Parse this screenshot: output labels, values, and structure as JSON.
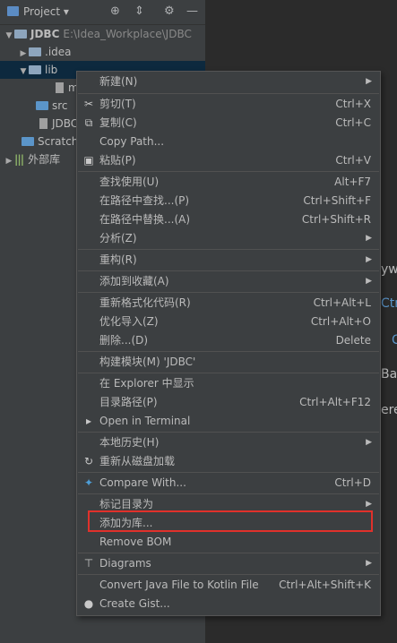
{
  "toolbar": {
    "title": "Project",
    "icons": [
      "target-icon",
      "collapse-icon",
      "gear-icon",
      "hide-icon"
    ]
  },
  "tree": {
    "root_name": "JDBC",
    "root_path": "E:\\Idea_Workplace\\JDBC",
    "idea": ".idea",
    "lib": "lib",
    "lib_child": "m",
    "src": "src",
    "iml": "JDBC",
    "scratches": "Scratche",
    "external": "外部库"
  },
  "editor_ghost": [
    "yw",
    "Ctr",
    "C",
    "Ba",
    "ere"
  ],
  "menu": {
    "new": "新建(N)",
    "cut": "剪切(T)",
    "cut_sc": "Ctrl+X",
    "copy": "复制(C)",
    "copy_sc": "Ctrl+C",
    "copy_path": "Copy Path...",
    "paste": "粘贴(P)",
    "paste_sc": "Ctrl+V",
    "find_usages": "查找使用(U)",
    "find_usages_sc": "Alt+F7",
    "find_in_path": "在路径中查找...(P)",
    "find_in_path_sc": "Ctrl+Shift+F",
    "replace_in_path": "在路径中替换...(A)",
    "replace_in_path_sc": "Ctrl+Shift+R",
    "analyze": "分析(Z)",
    "refactor": "重构(R)",
    "add_favorites": "添加到收藏(A)",
    "reformat": "重新格式化代码(R)",
    "reformat_sc": "Ctrl+Alt+L",
    "optimize_imports": "优化导入(Z)",
    "optimize_imports_sc": "Ctrl+Alt+O",
    "delete": "删除...(D)",
    "delete_sc": "Delete",
    "build_module": "构建模块(M) 'JDBC'",
    "show_explorer": "在 Explorer 中显示",
    "dir_path": "目录路径(P)",
    "dir_path_sc": "Ctrl+Alt+F12",
    "open_terminal": "Open in Terminal",
    "local_history": "本地历史(H)",
    "reload_disk": "重新从磁盘加载",
    "compare_with": "Compare With...",
    "compare_with_sc": "Ctrl+D",
    "mark_dir": "标记目录为",
    "add_library": "添加为库...",
    "remove_bom": "Remove BOM",
    "diagrams": "Diagrams",
    "convert_kotlin": "Convert Java File to Kotlin File",
    "convert_kotlin_sc": "Ctrl+Alt+Shift+K",
    "create_gist": "Create Gist..."
  },
  "highlight_color": "#e0312b"
}
